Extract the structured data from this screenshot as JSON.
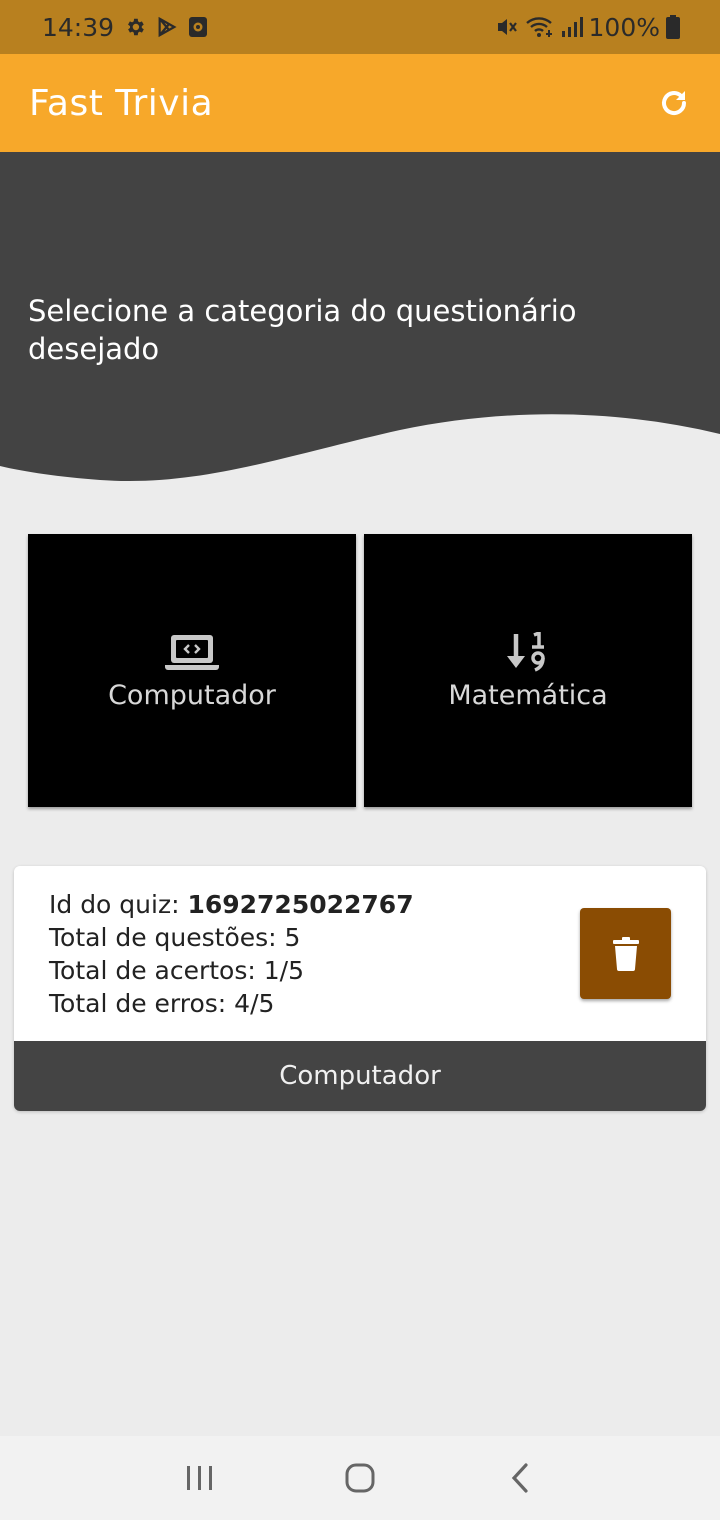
{
  "status_bar": {
    "time": "14:39",
    "battery": "100%",
    "icons_left": [
      "gear-icon",
      "play-store-icon",
      "media-icon"
    ],
    "icons_right": [
      "mute-icon",
      "wifi-icon",
      "signal-icon",
      "battery-icon"
    ]
  },
  "app_bar": {
    "title": "Fast Trivia",
    "action_icon": "refresh-icon",
    "background": "#f7a82a"
  },
  "header": {
    "text": "Selecione a categoria do questionário desejado",
    "background": "#434343"
  },
  "categories": [
    {
      "label": "Computador",
      "icon": "laptop-code-icon"
    },
    {
      "label": "Matemática",
      "icon": "sort-numeric-down-icon"
    }
  ],
  "result": {
    "id_label": "Id do quiz: ",
    "id_value": "1692725022767",
    "total_questions": "Total de questões: 5",
    "total_correct": "Total de acertos: 1/5",
    "total_wrong": "Total de erros: 4/5",
    "category": "Computador",
    "delete_icon": "trash-icon",
    "delete_color": "#8a4c03"
  },
  "nav_bar": {
    "buttons": [
      "recents-icon",
      "home-icon",
      "back-icon"
    ]
  }
}
